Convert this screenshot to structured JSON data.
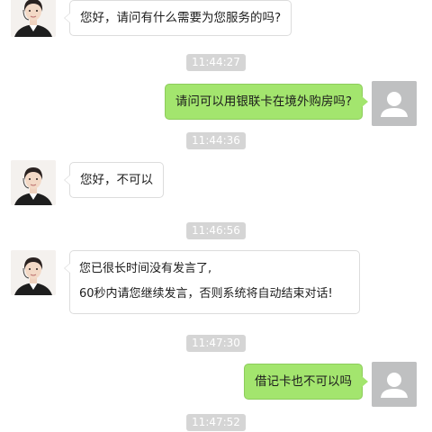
{
  "colors": {
    "background": "#ffffff",
    "agent_bubble": "#ffffff",
    "user_bubble": "#a3e56e",
    "timestamp_bg": "#d5d5d5",
    "user_avatar_bg": "#bfc0c1"
  },
  "avatars": {
    "agent": "customer-service-agent-icon",
    "user": "default-user-icon"
  },
  "chat": {
    "msg1": {
      "sender": "agent",
      "text": "您好，请问有什么需要为您服务的吗?"
    },
    "ts1": "11:44:27",
    "msg2": {
      "sender": "user",
      "text": "请问可以用银联卡在境外购房吗?"
    },
    "ts2": "11:44:36",
    "msg3": {
      "sender": "agent",
      "text": "您好，不可以"
    },
    "ts3": "11:46:56",
    "msg4": {
      "sender": "agent",
      "line1": "您已很长时间没有发言了,",
      "line2": "60秒内请您继续发言，否则系统将自动结束对话!"
    },
    "ts4": "11:47:30",
    "msg5": {
      "sender": "user",
      "text": "借记卡也不可以吗"
    },
    "ts5": "11:47:52"
  }
}
